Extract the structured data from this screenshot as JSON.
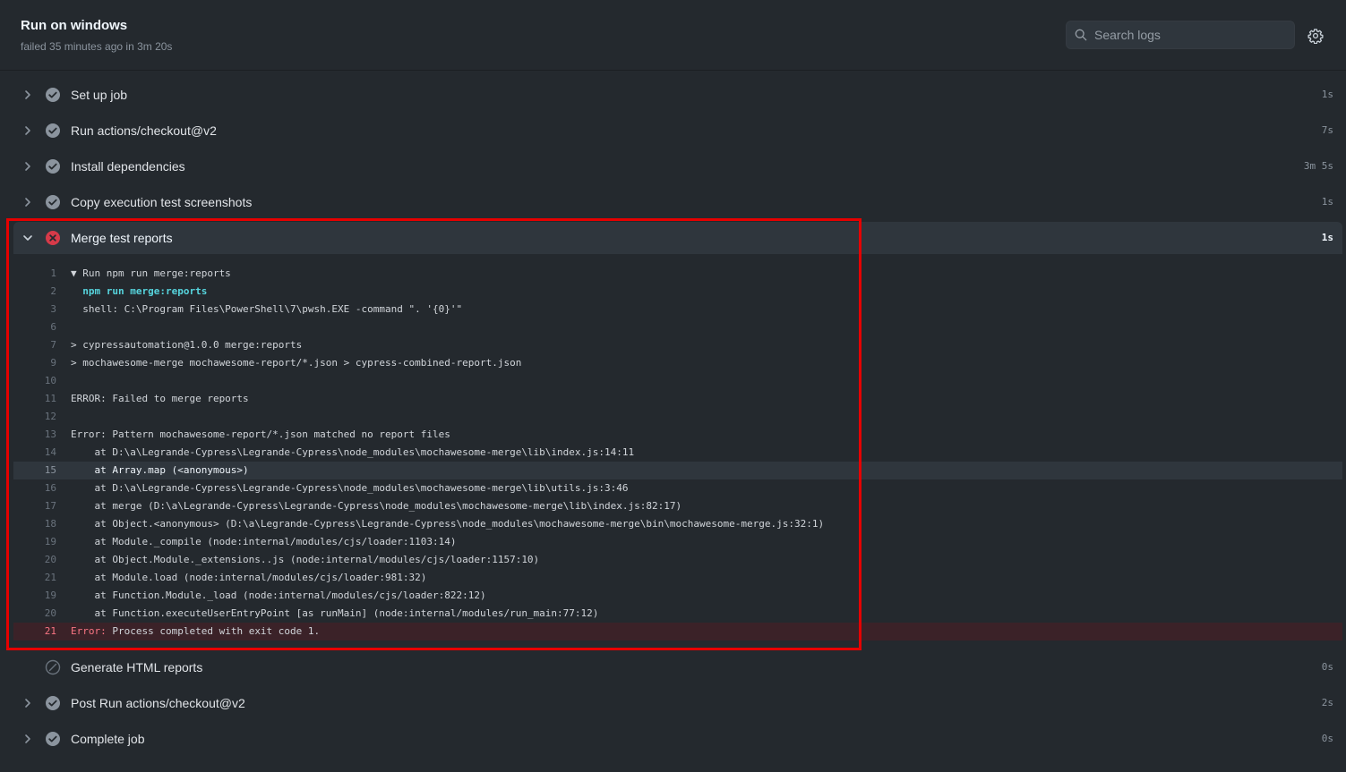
{
  "header": {
    "title": "Run on windows",
    "subtitle": "failed 35 minutes ago in 3m 20s",
    "search_placeholder": "Search logs"
  },
  "steps": [
    {
      "name": "Set up job",
      "duration": "1s",
      "status": "success"
    },
    {
      "name": "Run actions/checkout@v2",
      "duration": "7s",
      "status": "success"
    },
    {
      "name": "Install dependencies",
      "duration": "3m 5s",
      "status": "success"
    },
    {
      "name": "Copy execution test screenshots",
      "duration": "1s",
      "status": "success"
    },
    {
      "name": "Merge test reports",
      "duration": "1s",
      "status": "failure"
    },
    {
      "name": "Generate HTML reports",
      "duration": "0s",
      "status": "skipped"
    },
    {
      "name": "Post Run actions/checkout@v2",
      "duration": "2s",
      "status": "success"
    },
    {
      "name": "Complete job",
      "duration": "0s",
      "status": "success"
    }
  ],
  "log": [
    {
      "n": "1",
      "text": "▼ Run npm run merge:reports"
    },
    {
      "n": "2",
      "text": "  npm run merge:reports"
    },
    {
      "n": "3",
      "text": "  shell: C:\\Program Files\\PowerShell\\7\\pwsh.EXE -command \". '{0}'\""
    },
    {
      "n": "6",
      "text": ""
    },
    {
      "n": "7",
      "text": "> cypressautomation@1.0.0 merge:reports"
    },
    {
      "n": "9",
      "text": "> mochawesome-merge mochawesome-report/*.json > cypress-combined-report.json"
    },
    {
      "n": "10",
      "text": ""
    },
    {
      "n": "11",
      "text": "ERROR: Failed to merge reports"
    },
    {
      "n": "12",
      "text": ""
    },
    {
      "n": "13",
      "text": "Error: Pattern mochawesome-report/*.json matched no report files"
    },
    {
      "n": "14",
      "text": "    at D:\\a\\Legrande-Cypress\\Legrande-Cypress\\node_modules\\mochawesome-merge\\lib\\index.js:14:11"
    },
    {
      "n": "15",
      "text": "    at Array.map (<anonymous>)"
    },
    {
      "n": "16",
      "text": "    at D:\\a\\Legrande-Cypress\\Legrande-Cypress\\node_modules\\mochawesome-merge\\lib\\utils.js:3:46"
    },
    {
      "n": "17",
      "text": "    at merge (D:\\a\\Legrande-Cypress\\Legrande-Cypress\\node_modules\\mochawesome-merge\\lib\\index.js:82:17)"
    },
    {
      "n": "18",
      "text": "    at Object.<anonymous> (D:\\a\\Legrande-Cypress\\Legrande-Cypress\\node_modules\\mochawesome-merge\\bin\\mochawesome-merge.js:32:1)"
    },
    {
      "n": "19",
      "text": "    at Module._compile (node:internal/modules/cjs/loader:1103:14)"
    },
    {
      "n": "20",
      "text": "    at Object.Module._extensions..js (node:internal/modules/cjs/loader:1157:10)"
    },
    {
      "n": "21",
      "text": "    at Module.load (node:internal/modules/cjs/loader:981:32)"
    },
    {
      "n": "19",
      "text": "    at Function.Module._load (node:internal/modules/cjs/loader:822:12)"
    },
    {
      "n": "20",
      "text": "    at Function.executeUserEntryPoint [as runMain] (node:internal/modules/run_main:77:12)"
    },
    {
      "n": "21",
      "error_prefix": "Error:",
      "text": " Process completed with exit code 1."
    }
  ]
}
